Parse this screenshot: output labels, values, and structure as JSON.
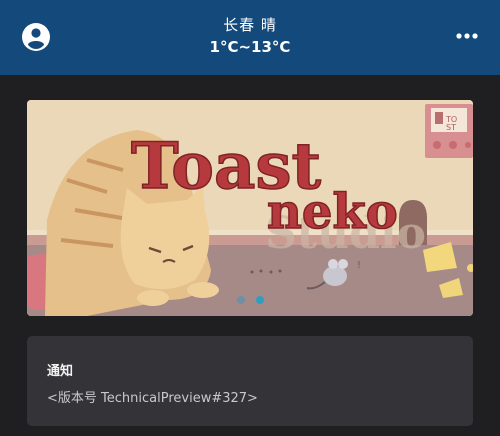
{
  "header": {
    "weather_line1": "长春 晴",
    "weather_line2": "1°C~13°C",
    "avatar_icon": "account-circle-icon",
    "menu_icon": "more-horizontal-icon"
  },
  "banner": {
    "title_line1": "Toast",
    "title_line2": "neko",
    "carousel_active_index": 1,
    "carousel_count": 2
  },
  "notice": {
    "title": "通知",
    "body": "<版本号 TechnicalPreview#327>"
  },
  "colors": {
    "header_bg": "#144a7b",
    "page_bg": "#1f1e21",
    "card_bg": "#333338",
    "dot_active": "#2f9ec1",
    "dot_inactive": "#6f8fa6"
  }
}
